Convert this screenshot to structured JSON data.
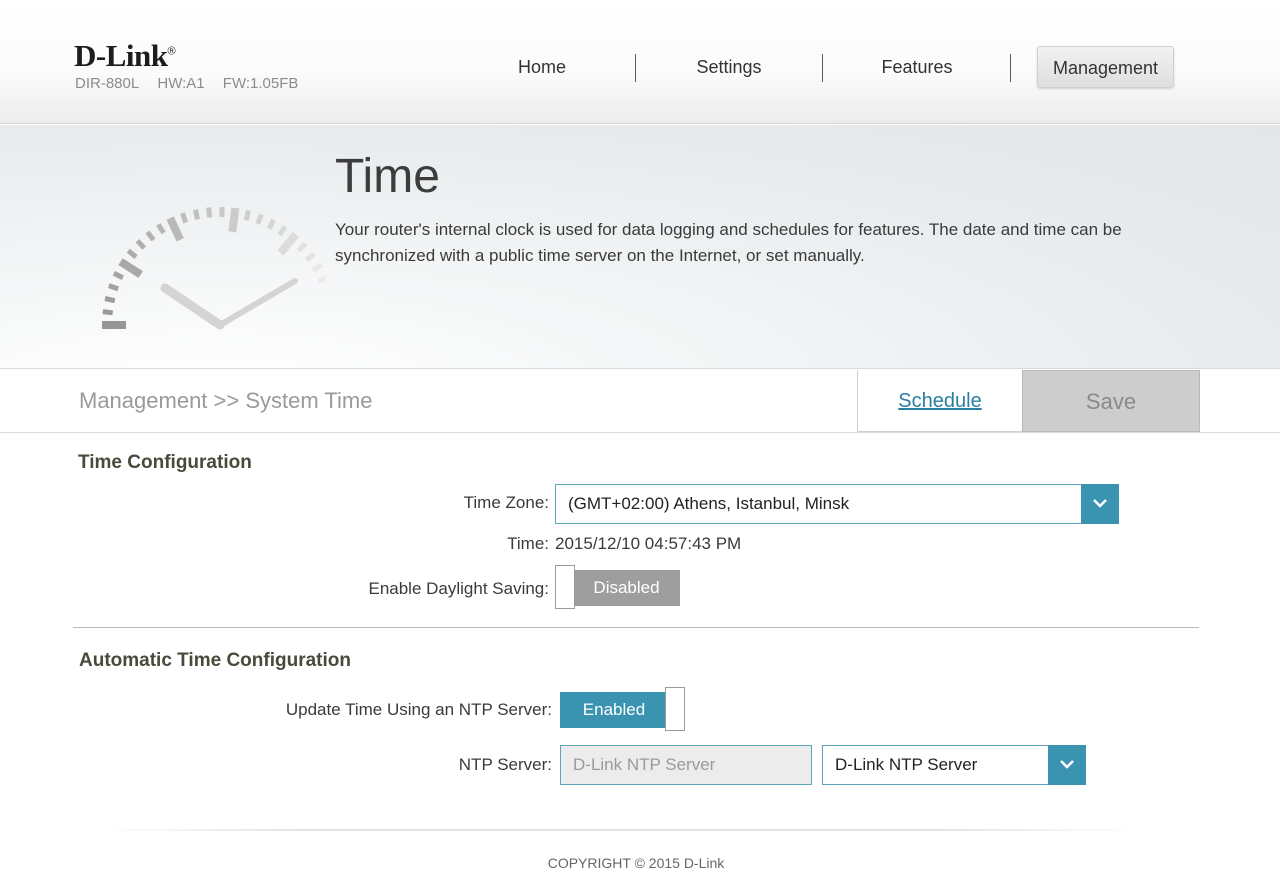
{
  "header": {
    "logo": "D-Link",
    "logo_mark": "®",
    "model": "DIR-880L",
    "hw": "HW:A1",
    "fw": "FW:1.05FB",
    "nav": [
      {
        "label": "Home"
      },
      {
        "label": "Settings"
      },
      {
        "label": "Features"
      },
      {
        "label": "Management",
        "active": true
      }
    ]
  },
  "banner": {
    "title": "Time",
    "description": "Your router's internal clock is used for data logging and schedules for features. The date and time can be synchronized with a public time server on the Internet, or set manually.",
    "icon": "clock-icon"
  },
  "toolbar": {
    "breadcrumb": "Management >> System Time",
    "schedule_label": "Schedule",
    "save_label": "Save"
  },
  "time_config": {
    "title": "Time Configuration",
    "timezone_label": "Time Zone:",
    "timezone_value": "(GMT+02:00) Athens, Istanbul, Minsk",
    "time_label": "Time:",
    "time_value": "2015/12/10 04:57:43 PM",
    "dst_label": "Enable Daylight Saving:",
    "dst_value": "Disabled"
  },
  "auto_time": {
    "title": "Automatic Time Configuration",
    "ntp_update_label": "Update Time Using an NTP Server:",
    "ntp_update_value": "Enabled",
    "ntp_server_label": "NTP Server:",
    "ntp_server_placeholder": "D-Link NTP Server",
    "ntp_server_select": "D-Link NTP Server"
  },
  "footer": {
    "copyright": "COPYRIGHT © 2015 D-Link"
  },
  "colors": {
    "accent": "#3a93b0",
    "link": "#2a7fa0",
    "disabled_toggle": "#9e9e9e",
    "save_bg": "#cdcdcd"
  }
}
